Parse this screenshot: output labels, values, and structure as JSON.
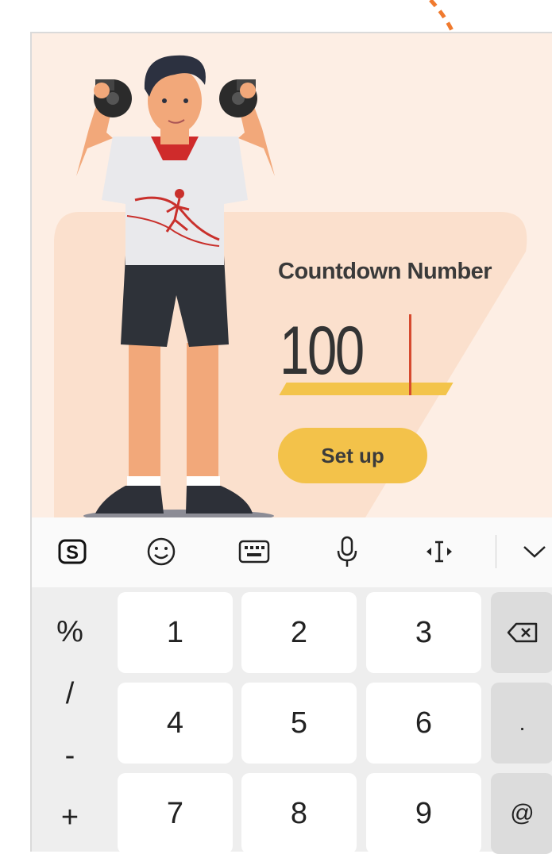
{
  "card": {
    "title": "Countdown Number",
    "number_value": "100",
    "setup_button": "Set up"
  },
  "toolbar": {
    "icons": [
      "sogou-logo-icon",
      "emoji-icon",
      "keyboard-icon",
      "microphone-icon",
      "cursor-move-icon",
      "chevron-down-icon"
    ]
  },
  "keyboard": {
    "symbols": [
      "%",
      "/",
      "-",
      "+"
    ],
    "row1": [
      "1",
      "2",
      "3"
    ],
    "row2": [
      "4",
      "5",
      "6"
    ],
    "row3": [
      "7",
      "8",
      "9"
    ],
    "side_keys": [
      "backspace-icon",
      ".",
      "@"
    ],
    "dot_label": ".",
    "at_label": "@"
  },
  "colors": {
    "card_bg": "#fdeee4",
    "accent_orange": "#f07a2e",
    "button_yellow": "#f3c24a",
    "caret": "#d64a2e"
  }
}
